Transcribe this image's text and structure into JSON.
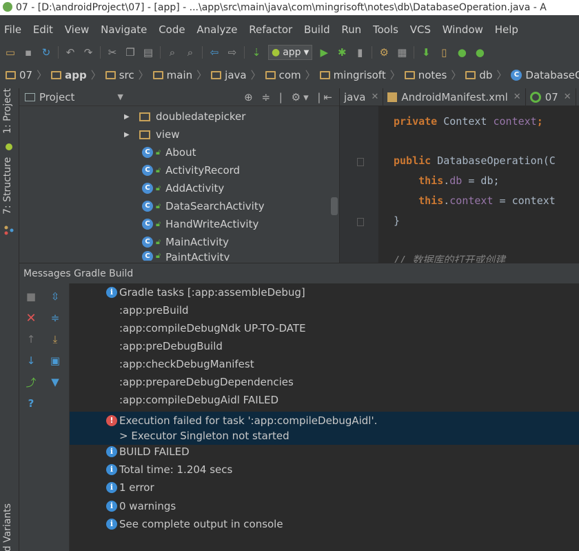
{
  "window": {
    "title": "07 - [D:\\androidProject\\07] - [app] - ...\\app\\src\\main\\java\\com\\mingrisoft\\notes\\db\\DatabaseOperation.java - A"
  },
  "menu": {
    "items": [
      "File",
      "Edit",
      "View",
      "Navigate",
      "Code",
      "Analyze",
      "Refactor",
      "Build",
      "Run",
      "Tools",
      "VCS",
      "Window",
      "Help"
    ]
  },
  "toolbar": {
    "run_config": "app"
  },
  "breadcrumb": {
    "items": [
      "07",
      "app",
      "src",
      "main",
      "java",
      "com",
      "mingrisoft",
      "notes",
      "db",
      "DatabaseOperation"
    ]
  },
  "sidebar": {
    "project_tab": "1: Project",
    "structure_tab": "7: Structure",
    "variants_tab": "ild Variants"
  },
  "project_panel": {
    "title": "Project",
    "tree": [
      {
        "type": "folder",
        "label": "doubledatepicker"
      },
      {
        "type": "folder",
        "label": "view"
      },
      {
        "type": "class",
        "label": "About"
      },
      {
        "type": "class",
        "label": "ActivityRecord"
      },
      {
        "type": "class",
        "label": "AddActivity"
      },
      {
        "type": "class",
        "label": "DataSearchActivity"
      },
      {
        "type": "class",
        "label": "HandWriteActivity"
      },
      {
        "type": "class",
        "label": "MainActivity"
      },
      {
        "type": "class",
        "label": "PaintActivity"
      }
    ]
  },
  "editor": {
    "tabs": [
      {
        "label": "java"
      },
      {
        "label": "AndroidManifest.xml"
      },
      {
        "label": "07"
      }
    ],
    "code": {
      "l1_kw": "private",
      "l1_type": " Context ",
      "l1_field": "context",
      "l1_end": ";",
      "l2_kw": "public",
      "l2_rest": " DatabaseOperation(C",
      "l3_kw": "this",
      "l3_dot": ".",
      "l3_field": "db",
      "l3_rest": " = db;",
      "l4_kw": "this",
      "l4_dot": ".",
      "l4_field": "context",
      "l4_rest": " = context",
      "l5": "}",
      "l6": "// 数据库的打开或创建"
    }
  },
  "messages": {
    "header": "Messages Gradle Build",
    "rows": [
      {
        "icon": "info",
        "text": "Gradle tasks [:app:assembleDebug]"
      },
      {
        "icon": "",
        "text": ":app:preBuild"
      },
      {
        "icon": "",
        "text": ":app:compileDebugNdk UP-TO-DATE"
      },
      {
        "icon": "",
        "text": ":app:preDebugBuild"
      },
      {
        "icon": "",
        "text": ":app:checkDebugManifest"
      },
      {
        "icon": "",
        "text": ":app:prepareDebugDependencies"
      },
      {
        "icon": "",
        "text": ":app:compileDebugAidl FAILED"
      },
      {
        "icon": "error",
        "text": "Execution failed for task ':app:compileDebugAidl'.",
        "text2": "> Executor Singleton not started"
      },
      {
        "icon": "info",
        "text": "BUILD FAILED"
      },
      {
        "icon": "info",
        "text": "Total time: 1.204 secs"
      },
      {
        "icon": "info",
        "text": "1 error"
      },
      {
        "icon": "info",
        "text": "0 warnings"
      },
      {
        "icon": "info",
        "text": "See complete output in console"
      }
    ]
  },
  "colors": {
    "background": "#3c3f41",
    "editor_bg": "#2b2b2b",
    "selection": "#0d293e",
    "keyword": "#cc7832",
    "field": "#9876aa"
  }
}
